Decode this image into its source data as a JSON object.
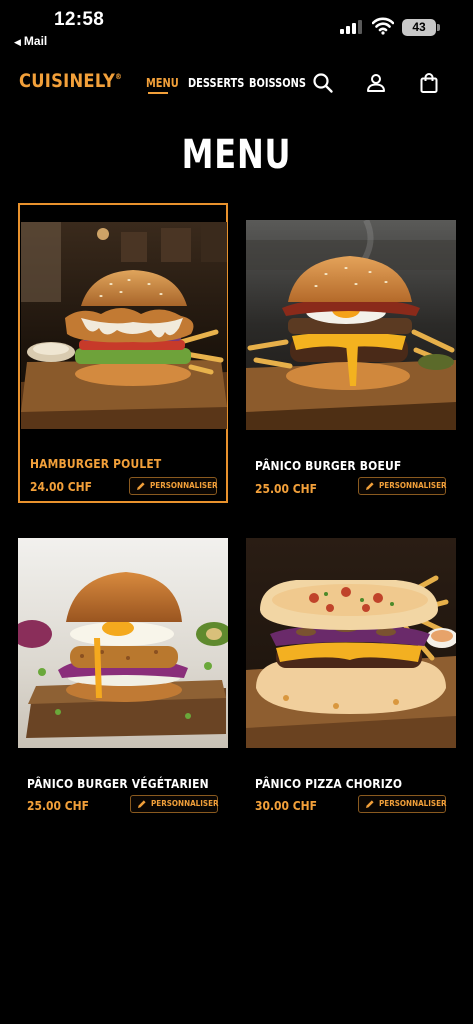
{
  "status_bar": {
    "time": "12:58",
    "back_label": "Mail",
    "battery": "43"
  },
  "nav": {
    "brand": "CUISINELY",
    "brand_mark": "®",
    "links": [
      "MENU",
      "DESSERTS",
      "BOISSONS"
    ],
    "active_link": "MENU",
    "icons": [
      "search-icon",
      "user-icon",
      "shopping-bag-icon"
    ],
    "accent_color": "#f2a03a"
  },
  "page": {
    "title": "MENU"
  },
  "products": [
    {
      "name": "HAMBURGER POULET",
      "price": "24.00 CHF",
      "action": "PERSONNALISER",
      "selected": true
    },
    {
      "name": "PÂNICO BURGER BOEUF",
      "price": "25.00 CHF",
      "action": "PERSONNALISER",
      "selected": false
    },
    {
      "name": "PÂNICO BURGER VÉGÉTARIEN",
      "price": "25.00 CHF",
      "action": "PERSONNALISER",
      "selected": false
    },
    {
      "name": "PÂNICO PIZZA CHORIZO",
      "price": "30.00 CHF",
      "action": "PERSONNALISER",
      "selected": false
    }
  ]
}
